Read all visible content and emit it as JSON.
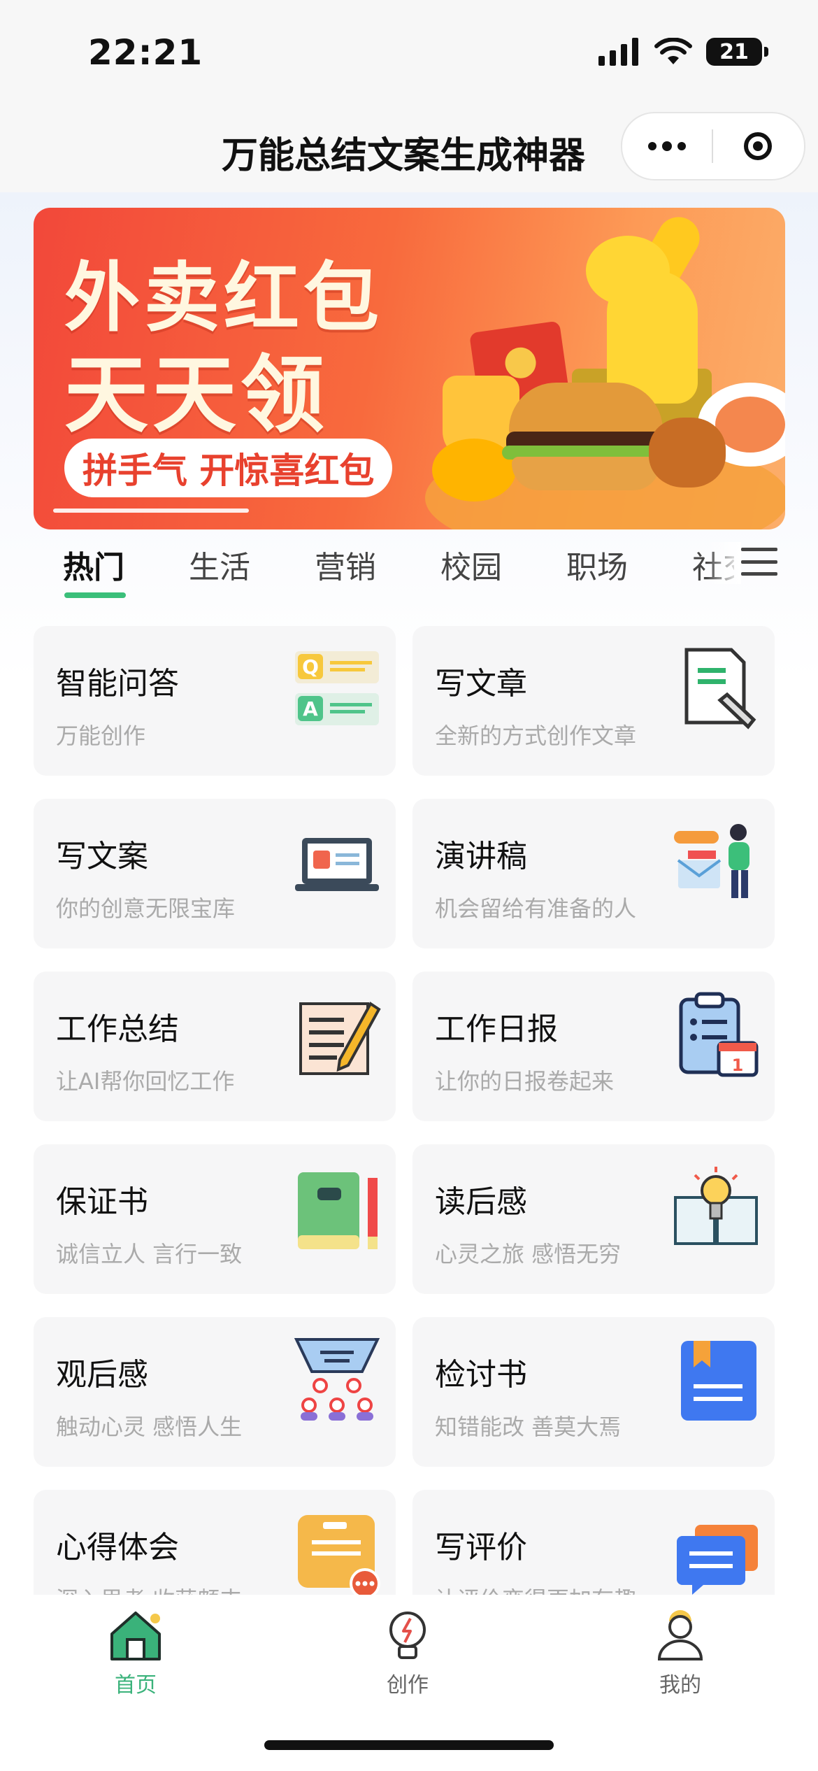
{
  "status": {
    "time": "22:21",
    "battery": "21"
  },
  "nav": {
    "title": "万能总结文案生成神器"
  },
  "banner": {
    "line1": "外卖红包",
    "line2": "天天领",
    "pill": "拼手气 开惊喜红包"
  },
  "tabs": [
    "热门",
    "生活",
    "营销",
    "校园",
    "职场",
    "社交"
  ],
  "cards": [
    {
      "title": "智能问答",
      "subtitle": "万能创作",
      "icon": "qa-icon"
    },
    {
      "title": "写文章",
      "subtitle": "全新的方式创作文章",
      "icon": "article-icon"
    },
    {
      "title": "写文案",
      "subtitle": "你的创意无限宝库",
      "icon": "laptop-icon"
    },
    {
      "title": "演讲稿",
      "subtitle": "机会留给有准备的人",
      "icon": "speaker-icon"
    },
    {
      "title": "工作总结",
      "subtitle": "让AI帮你回忆工作",
      "icon": "notepad-pencil-icon"
    },
    {
      "title": "工作日报",
      "subtitle": "让你的日报卷起来",
      "icon": "clipboard-calendar-icon"
    },
    {
      "title": "保证书",
      "subtitle": "诚信立人 言行一致",
      "icon": "notebook-pencil-icon"
    },
    {
      "title": "读后感",
      "subtitle": "心灵之旅 感悟无穷",
      "icon": "book-lightbulb-icon"
    },
    {
      "title": "观后感",
      "subtitle": "触动心灵 感悟人生",
      "icon": "audience-icon"
    },
    {
      "title": "检讨书",
      "subtitle": "知错能改 善莫大焉",
      "icon": "bookmark-doc-icon"
    },
    {
      "title": "心得体会",
      "subtitle": "深入思考 收获颇丰",
      "icon": "chat-card-icon"
    },
    {
      "title": "写评价",
      "subtitle": "让评价变得更加有趣",
      "icon": "message-stack-icon"
    }
  ],
  "tabbar": [
    {
      "label": "首页",
      "icon": "home-icon"
    },
    {
      "label": "创作",
      "icon": "bulb-icon"
    },
    {
      "label": "我的",
      "icon": "profile-icon"
    }
  ],
  "colors": {
    "accent": "#3ab27a",
    "banner": "#f2483a",
    "card_bg": "#f6f6f7"
  }
}
